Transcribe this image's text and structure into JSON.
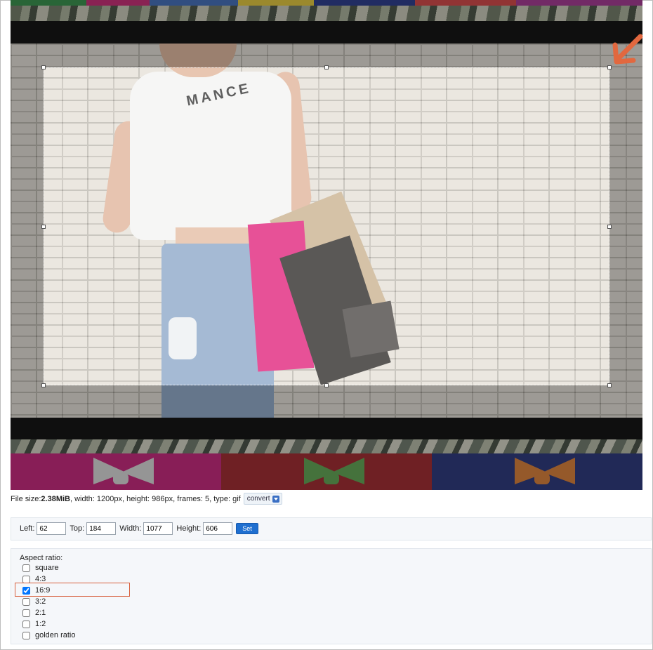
{
  "image_preview": {
    "shirt_text": "MANCE",
    "band_colors": [
      "#c31974",
      "#9c1c22",
      "#1d2b75"
    ],
    "tie_colors": [
      "#d9d9d9",
      "#57a14a",
      "#d9782c"
    ],
    "annotation_color": "#e2683f"
  },
  "file_info": {
    "prefix": "File size: ",
    "size": "2.38MiB",
    "details": ", width: 1200px, height: 986px, frames: 5, type: gif",
    "convert_label": "convert"
  },
  "crop": {
    "left_label": "Left:",
    "left_value": "62",
    "top_label": "Top:",
    "top_value": "184",
    "width_label": "Width:",
    "width_value": "1077",
    "height_label": "Height:",
    "height_value": "606",
    "set_label": "Set"
  },
  "aspect": {
    "title": "Aspect ratio:",
    "options": [
      {
        "label": "square",
        "checked": false
      },
      {
        "label": "4:3",
        "checked": false
      },
      {
        "label": "16:9",
        "checked": true
      },
      {
        "label": "3:2",
        "checked": false
      },
      {
        "label": "2:1",
        "checked": false
      },
      {
        "label": "1:2",
        "checked": false
      },
      {
        "label": "golden ratio",
        "checked": false
      }
    ]
  }
}
